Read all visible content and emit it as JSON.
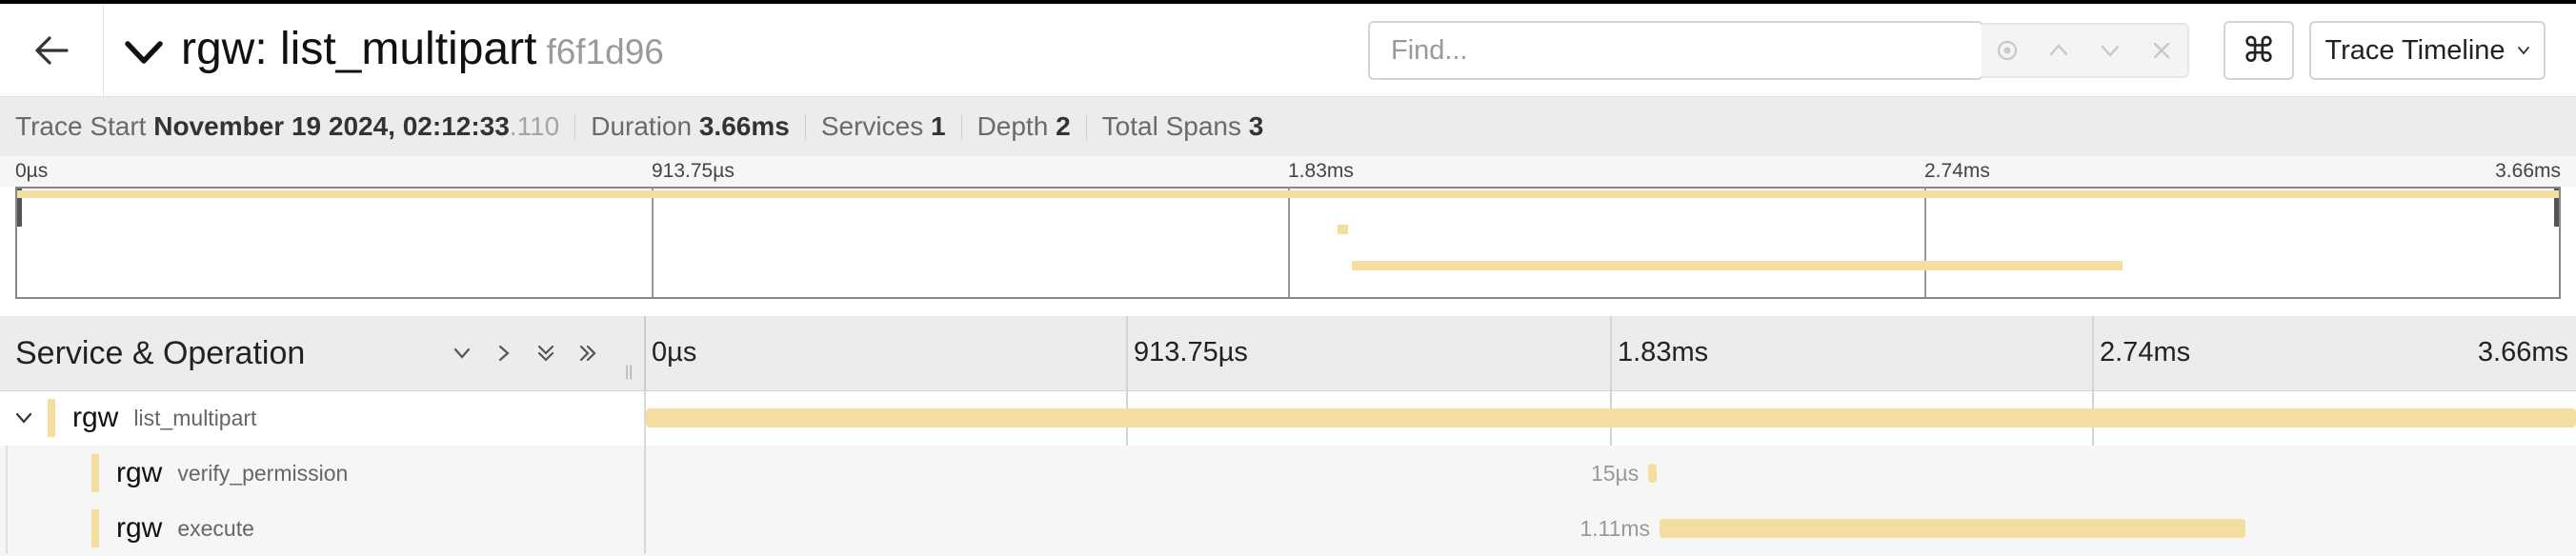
{
  "header": {
    "service": "rgw",
    "operation": "list_multipart",
    "title": "rgw: list_multipart",
    "trace_id": "f6f1d96",
    "search": {
      "placeholder": "Find..."
    },
    "view_select": "Trace Timeline"
  },
  "summary": {
    "trace_start_label": "Trace Start",
    "trace_start_value": "November 19 2024, 02:12:33",
    "trace_start_ms": ".110",
    "duration_label": "Duration",
    "duration_value": "3.66ms",
    "services_label": "Services",
    "services_value": "1",
    "depth_label": "Depth",
    "depth_value": "2",
    "total_spans_label": "Total Spans",
    "total_spans_value": "3"
  },
  "minimap": {
    "ticks": [
      "0µs",
      "913.75µs",
      "1.83ms",
      "2.74ms",
      "3.66ms"
    ]
  },
  "timeline": {
    "column_title": "Service & Operation",
    "ticks": [
      "0µs",
      "913.75µs",
      "1.83ms",
      "2.74ms",
      "3.66ms"
    ],
    "total_duration_ms": 3.66
  },
  "spans": [
    {
      "service": "rgw",
      "operation": "list_multipart",
      "depth": 0,
      "start_fraction": 0.0,
      "duration_fraction": 1.0,
      "label": ""
    },
    {
      "service": "rgw",
      "operation": "verify_permission",
      "depth": 1,
      "start_fraction": 0.5194,
      "duration_fraction": 0.0041,
      "label": "15µs"
    },
    {
      "service": "rgw",
      "operation": "execute",
      "depth": 1,
      "start_fraction": 0.5252,
      "duration_fraction": 0.3033,
      "label": "1.11ms"
    }
  ],
  "colors": {
    "span_bar": "#f3dea0",
    "header_bg": "#ececec",
    "title_text": "#111111",
    "trace_id_text": "#9a9a9a"
  },
  "icons": [
    "arrow-left-icon",
    "chevron-down-icon",
    "target-icon",
    "chevron-up-icon",
    "chevron-down-icon",
    "close-icon",
    "command-icon",
    "collapse-all-icon",
    "expand-icon",
    "expand-all-icon",
    "expand-double-icon"
  ]
}
